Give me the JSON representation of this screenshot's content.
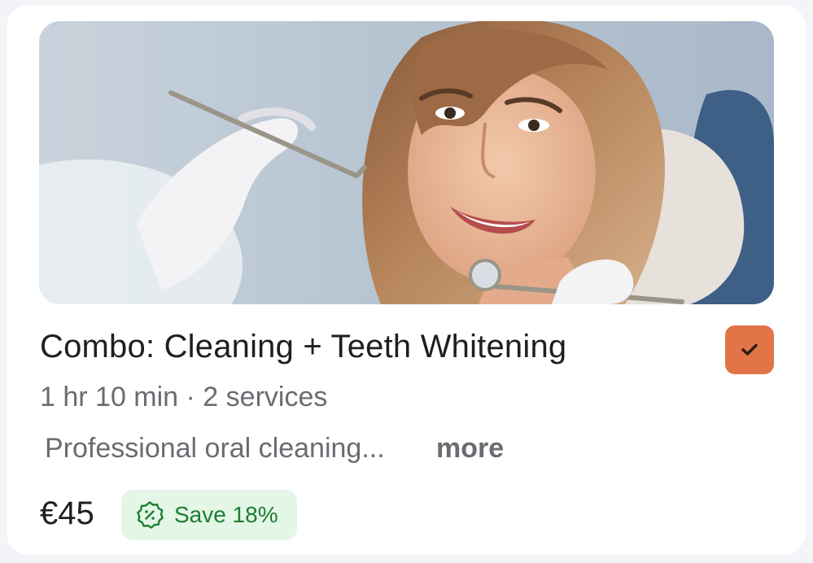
{
  "card": {
    "image_alt": "Smiling woman at dental checkup",
    "title": "Combo: Cleaning + Teeth Whitening",
    "selected": true,
    "meta": "1 hr 10 min · 2 services",
    "description": "Professional oral cleaning...",
    "more_label": "more",
    "price": "€45",
    "badge": {
      "icon": "discount-badge-icon",
      "label": "Save 18%"
    }
  },
  "colors": {
    "accent": "#e27448",
    "badge_bg": "#e4f6e6",
    "badge_text": "#1e7d32",
    "title_text": "#1f1f22",
    "muted_text": "#6b6b72"
  }
}
